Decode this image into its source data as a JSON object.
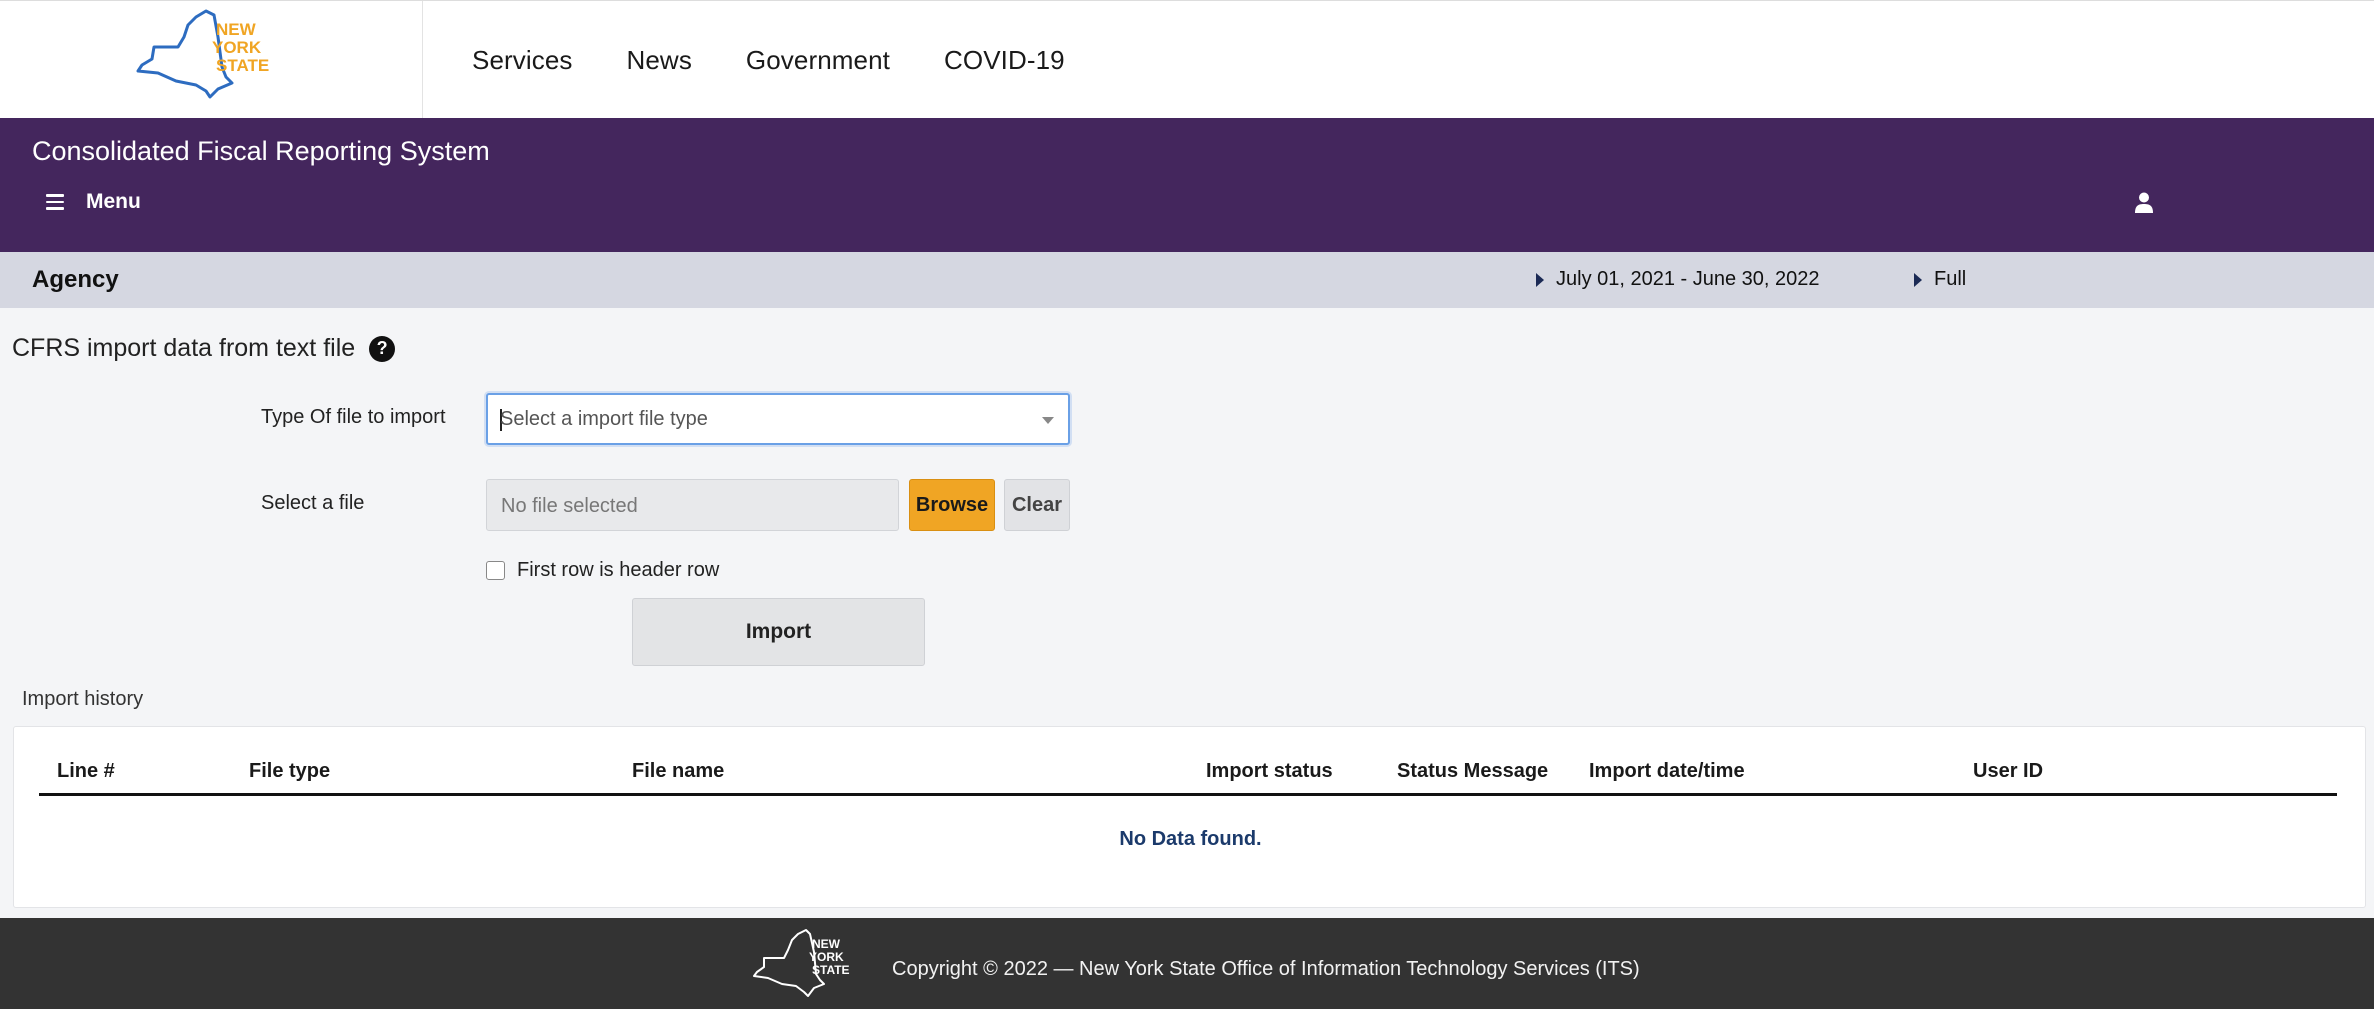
{
  "header": {
    "logo_text": [
      "NEW",
      "YORK",
      "STATE"
    ],
    "nav": [
      "Services",
      "News",
      "Government",
      "COVID-19"
    ]
  },
  "app_bar": {
    "title": "Consolidated Fiscal Reporting System",
    "menu_label": "Menu"
  },
  "context": {
    "title": "Agency",
    "fiscal_period": "July 01, 2021 - June 30, 2022",
    "report_mode": "Full"
  },
  "form": {
    "heading": "CFRS import data from text file",
    "help_glyph": "?",
    "file_type_label": "Type Of file to import",
    "file_type_placeholder": "Select a import file type",
    "file_label": "Select a file",
    "file_value": "No file selected",
    "browse_label": "Browse",
    "clear_label": "Clear",
    "header_row_label": "First row is header row",
    "header_row_checked": false,
    "import_label": "Import"
  },
  "history": {
    "label": "Import history",
    "columns": [
      "Line #",
      "File type",
      "File name",
      "Import status",
      "Status Message",
      "Import date/time",
      "User ID"
    ],
    "rows": [],
    "empty_message": "No Data found."
  },
  "footer": {
    "copyright": "Copyright © 2022 — New York State Office of Information Technology Services (ITS)"
  },
  "colors": {
    "app_bar": "#44265d",
    "context_bar": "#d5d7e1",
    "browse_button": "#f0a524",
    "logo_outline": "#2d6cc0",
    "logo_text": "#f0a524",
    "footer": "#333333"
  }
}
